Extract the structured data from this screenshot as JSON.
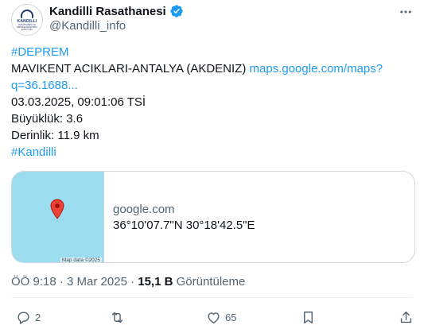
{
  "author": {
    "display_name": "Kandilli Rasathanesi",
    "handle": "@Kandilli_info",
    "avatar_text": "KANDILLI",
    "avatar_subtext": "RASATHANESI VE DEPREM ARAŞTIRMA ENSTİTÜSÜ",
    "verified": true
  },
  "body": {
    "hashtag_top": "#DEPREM",
    "location_text": "MAVIKENT ACIKLARI-ANTALYA (AKDENIZ) ",
    "maps_link_part1": "maps.google.com/maps?",
    "maps_link_part2": "q=36.1688...",
    "datetime": "03.03.2025, 09:01:06 TSİ",
    "magnitude": "Büyüklük: 3.6",
    "depth": "Derinlik: 11.9 km",
    "hashtag_bottom": "#Kandilli"
  },
  "card": {
    "domain": "google.com",
    "coordinates": "36°10'07.7\"N 30°18'42.5\"E",
    "map_credit": "Map data ©2025",
    "map_color": "#9cdcef",
    "pin_color": "#ea4335"
  },
  "meta": {
    "time_date": "ÖÖ 9:18 · 3 Mar 2025 · ",
    "views_count": "15,1 B",
    "views_label": " Görüntüleme"
  },
  "actions": {
    "reply_count": "2",
    "retweet_count": "",
    "like_count": "65",
    "bookmark_count": "",
    "share_count": ""
  },
  "colors": {
    "link": "#1d9bf0",
    "text": "#0f1419",
    "muted": "#536471",
    "verified": "#1d9bf0"
  }
}
